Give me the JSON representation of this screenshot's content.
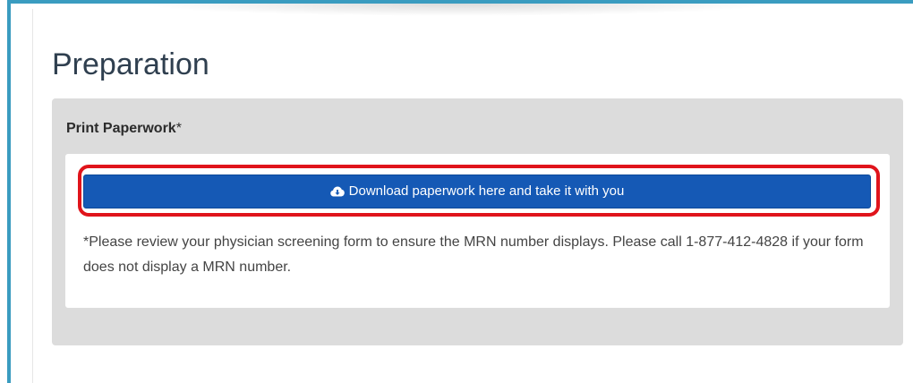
{
  "page": {
    "title": "Preparation"
  },
  "panel": {
    "heading": "Print Paperwork",
    "required_marker": "*"
  },
  "download": {
    "icon": "cloud-download-icon",
    "label": "Download paperwork here and take it with you"
  },
  "note": {
    "text": "*Please review your physician screening form to ensure the MRN number displays. Please call 1-877-412-4828 if your form does not display a MRN number."
  },
  "colors": {
    "button": "#1559b5",
    "highlight": "#e0141b",
    "frame_accent": "#3a9cc0",
    "panel_bg": "#dcdcdc"
  }
}
